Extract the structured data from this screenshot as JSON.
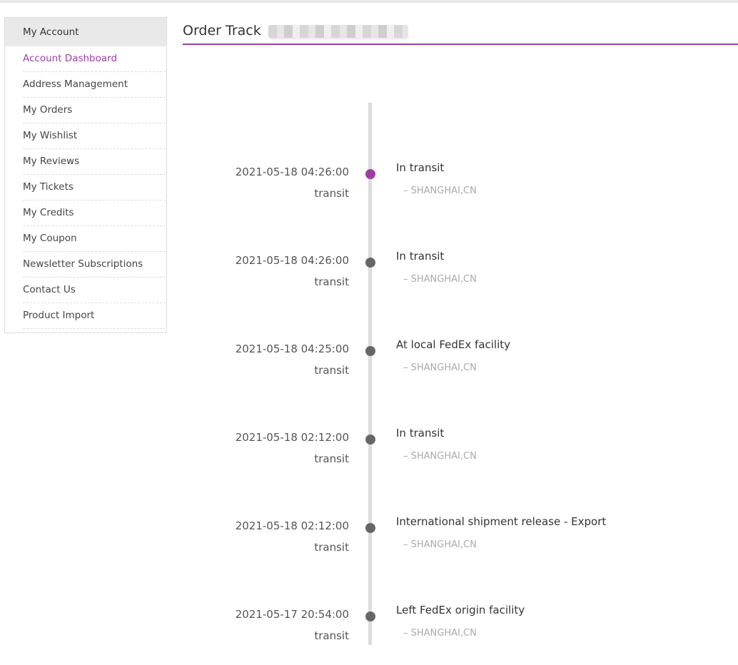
{
  "sidebar": {
    "title": "My Account",
    "items": [
      {
        "label": "Account Dashboard",
        "active": true
      },
      {
        "label": "Address Management"
      },
      {
        "label": "My Orders"
      },
      {
        "label": "My Wishlist"
      },
      {
        "label": "My Reviews"
      },
      {
        "label": "My Tickets"
      },
      {
        "label": "My Credits"
      },
      {
        "label": "My Coupon"
      },
      {
        "label": "Newsletter Subscriptions"
      },
      {
        "label": "Contact Us"
      },
      {
        "label": "Product Import"
      }
    ]
  },
  "main": {
    "title": "Order Track",
    "accent_color": "#9b3fa5",
    "events": [
      {
        "time": "2021-05-18 04:26:00",
        "type": "transit",
        "description": "In transit",
        "location": "– SHANGHAI,CN",
        "current": true
      },
      {
        "time": "2021-05-18 04:26:00",
        "type": "transit",
        "description": "In transit",
        "location": "– SHANGHAI,CN"
      },
      {
        "time": "2021-05-18 04:25:00",
        "type": "transit",
        "description": "At local FedEx facility",
        "location": "– SHANGHAI,CN"
      },
      {
        "time": "2021-05-18 02:12:00",
        "type": "transit",
        "description": "In transit",
        "location": "– SHANGHAI,CN"
      },
      {
        "time": "2021-05-18 02:12:00",
        "type": "transit",
        "description": "International shipment release - Export",
        "location": "– SHANGHAI,CN"
      },
      {
        "time": "2021-05-17 20:54:00",
        "type": "transit",
        "description": "Left FedEx origin facility",
        "location": "– SHANGHAI,CN"
      }
    ]
  }
}
